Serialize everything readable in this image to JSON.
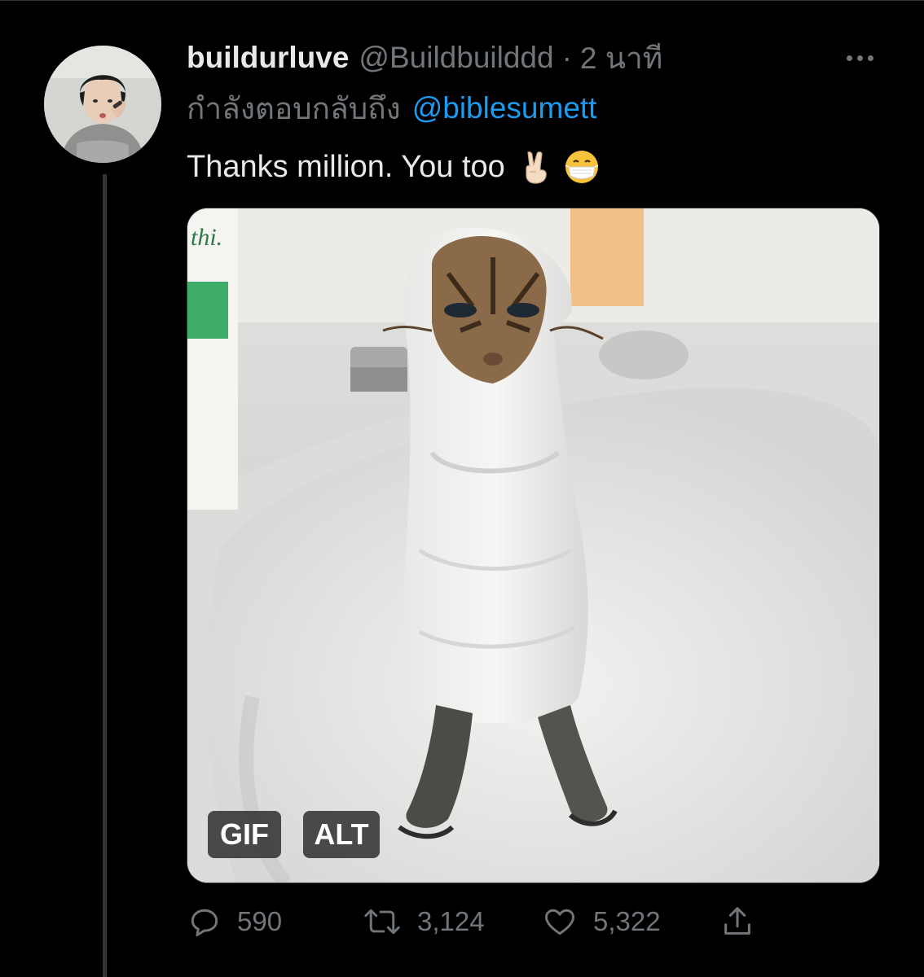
{
  "tweet": {
    "display_name": "buildurluve",
    "handle": "@Buildbuilddd",
    "separator": "·",
    "time": "2 นาที",
    "reply_context": {
      "prefix": "กำลังตอบกลับถึง",
      "mention": "@biblesumett"
    },
    "text": "Thanks million. You too",
    "emojis": [
      "victory-hand-emoji",
      "face-with-medical-mask-emoji"
    ],
    "media": {
      "description_icon": "cat-wrapped-in-towel-gif",
      "badges": {
        "gif": "GIF",
        "alt": "ALT"
      }
    },
    "actions": {
      "reply_count": "590",
      "retweet_count": "3,124",
      "like_count": "5,322"
    }
  },
  "colors": {
    "background": "#000000",
    "text_primary": "#e7e9ea",
    "text_secondary": "#71767b",
    "link": "#1d9bf0",
    "thread_line": "#333639"
  }
}
